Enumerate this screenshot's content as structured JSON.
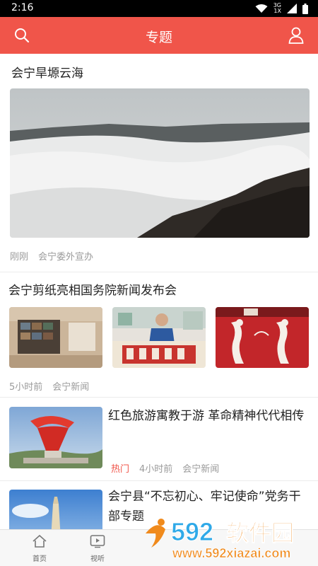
{
  "status_bar": {
    "time": "2:16",
    "network_label": "3G",
    "signal_small_label": "1X"
  },
  "header": {
    "title": "专题",
    "search_icon": "search-icon",
    "user_icon": "user-icon",
    "background_color": "#f0554a"
  },
  "articles": [
    {
      "title": "会宁旱塬云海",
      "meta": [
        "刚刚",
        "会宁委外宣办"
      ]
    },
    {
      "title": "会宁剪纸亮相国务院新闻发布会",
      "meta": [
        "5小时前",
        "会宁新闻"
      ]
    },
    {
      "title": "红色旅游寓教于游 革命精神代代相传",
      "tag": "热门",
      "meta": [
        "4小时前",
        "会宁新闻"
      ]
    },
    {
      "title": "会宁县“不忘初心、牢记使命”党务干部专题"
    }
  ],
  "tabbar": {
    "items": [
      {
        "label": "首页",
        "icon": "home-icon"
      },
      {
        "label": "视听",
        "icon": "video-icon"
      }
    ]
  },
  "watermark": {
    "brand": "592软件园",
    "url": "www.592xiazai.com"
  }
}
